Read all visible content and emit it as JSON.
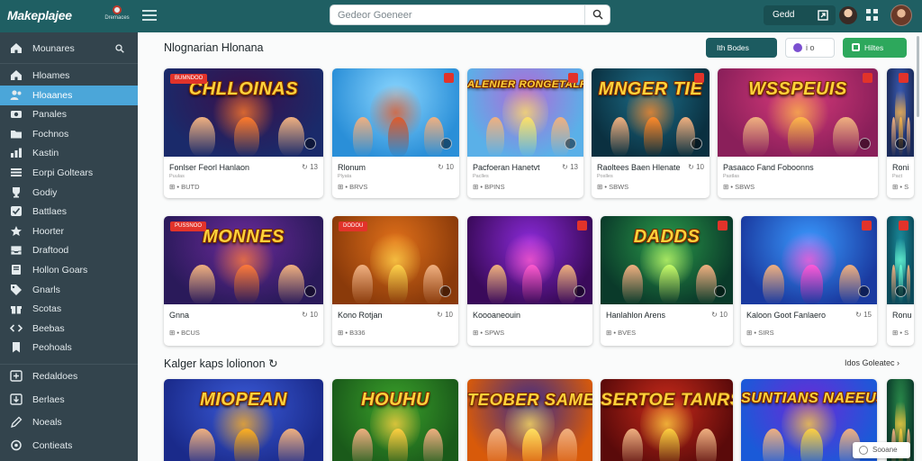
{
  "app": {
    "logo": "Makeplajee",
    "badge_label": "Dremaces",
    "search_placeholder": "Gedeor Goeneer",
    "top_pill_label": "Gedd"
  },
  "sidebar": {
    "header": "Mounares",
    "items": [
      {
        "label": "Hloames",
        "icon": "home-icon"
      },
      {
        "label": "Hloaanes",
        "icon": "users-icon",
        "active": true
      },
      {
        "label": "Panales",
        "icon": "camera-icon"
      },
      {
        "label": "Fochnos",
        "icon": "folder-icon"
      },
      {
        "label": "Kastin",
        "icon": "chart-icon"
      },
      {
        "label": "Eorpi Goltears",
        "icon": "list-icon"
      },
      {
        "label": "Godiy",
        "icon": "trophy-icon"
      },
      {
        "label": "Battlaes",
        "icon": "check-icon"
      },
      {
        "label": "Hoorter",
        "icon": "star-icon"
      },
      {
        "label": "Draftood",
        "icon": "inbox-icon"
      },
      {
        "label": "Hollon Goars",
        "icon": "book-icon"
      },
      {
        "label": "Gnarls",
        "icon": "tag-icon"
      },
      {
        "label": "Scotas",
        "icon": "gift-icon"
      },
      {
        "label": "Beebas",
        "icon": "code-icon"
      },
      {
        "label": "Peohoals",
        "icon": "bookmark-icon"
      }
    ],
    "footer_items": [
      {
        "label": "Redaldoes",
        "icon": "plus-square-icon"
      },
      {
        "label": "Berlaes",
        "icon": "download-icon"
      },
      {
        "label": "Noeals",
        "icon": "pencil-icon"
      },
      {
        "label": "Contieats",
        "icon": "settings-icon"
      }
    ]
  },
  "toolbar": {
    "primary_label": "Ith Bodes",
    "secondary_label": "i o",
    "green_label": "Hiltes"
  },
  "section1": {
    "title": "Nlognarian Hlonana"
  },
  "section2": {
    "title": "Kalger kaps lolionon",
    "link": "Idos Goleatec"
  },
  "row1": [
    {
      "art_title": "CHLLOINAS",
      "tag": "BUMNDOO",
      "name": "Fonlser Feorl Hanlaon",
      "acts": "↻ 13",
      "sub": "Puulas",
      "meta": "⊞ • BUTD",
      "palette": [
        "#1a2a6a",
        "#3a0f4a",
        "#ff7a2a"
      ]
    },
    {
      "art_title": "",
      "tag": "",
      "name": "Rlonum",
      "acts": "↻ 10",
      "sub": "Plyata",
      "meta": "⊞ • BRVS",
      "palette": [
        "#2a8fd8",
        "#8ad6ff",
        "#e05a2a"
      ]
    },
    {
      "art_title": "ALENIER RONGETALRS",
      "tag": "",
      "name": "Pacfoeran Hanetvt",
      "acts": "↻ 13",
      "sub": "Paclles",
      "meta": "⊞ • BPINS",
      "palette": [
        "#5ab0e8",
        "#b06ad8",
        "#ffe066"
      ]
    },
    {
      "art_title": "MNGER TIE",
      "tag": "",
      "name": "Raoltees Baen Hlenate",
      "acts": "↻ 10",
      "sub": "Poslles",
      "meta": "⊞ • SBWS",
      "palette": [
        "#0a3040",
        "#1d6f8a",
        "#ff8a2a"
      ]
    },
    {
      "art_title": "WSSPEUIS",
      "tag": "",
      "name": "Pasaaco Fand Foboonns",
      "acts": "",
      "sub": "Pastlas",
      "meta": "⊞ • SBWS",
      "palette": [
        "#8a1f5a",
        "#d83a7a",
        "#ffb84a"
      ]
    },
    {
      "art_title": "",
      "tag": "",
      "name": "Roni",
      "acts": "",
      "sub": "Pact",
      "meta": "⊞ • S",
      "palette": [
        "#1a2a5a",
        "#3a5ab0",
        "#ffb84a"
      ]
    }
  ],
  "row2": [
    {
      "art_title": "MONNES",
      "tag": "PUSSNOO",
      "name": "Gnna",
      "acts": "↻ 10",
      "meta": "⊞ • BCUS",
      "palette": [
        "#2a1a5a",
        "#6a2a9a",
        "#ff7a3a"
      ]
    },
    {
      "art_title": "",
      "tag": "DODOU",
      "name": "Kono Rotjan",
      "acts": "↻ 10",
      "meta": "⊞ • B336",
      "palette": [
        "#8a3a0a",
        "#e0701a",
        "#ffd24a"
      ]
    },
    {
      "art_title": "",
      "tag": "",
      "name": "Koooaneouin",
      "acts": "",
      "meta": "⊞ • SPWS",
      "palette": [
        "#3a0a5a",
        "#8a2ad8",
        "#ff5ad0"
      ]
    },
    {
      "art_title": "DADDS",
      "tag": "",
      "name": "Hanlahlon Arens",
      "acts": "↻ 10",
      "meta": "⊞ • BVES",
      "palette": [
        "#0a3a2a",
        "#2a9a4a",
        "#c8ff6a"
      ]
    },
    {
      "art_title": "",
      "tag": "",
      "name": "Kaloon Goot Fanlaero",
      "acts": "↻ 15",
      "meta": "⊞ • SIRS",
      "palette": [
        "#1a3aa0",
        "#3a9aff",
        "#ff5ad8"
      ]
    },
    {
      "art_title": "",
      "tag": "",
      "name": "Ronu",
      "acts": "",
      "meta": "⊞ • S",
      "palette": [
        "#0a4a5a",
        "#1a8a9a",
        "#6affd8"
      ]
    }
  ],
  "row3": [
    {
      "art_title": "MIOPEAN",
      "palette": [
        "#1a2a8a",
        "#3a5ad8",
        "#ffb020"
      ]
    },
    {
      "art_title": "HOUHU",
      "palette": [
        "#1a5a1a",
        "#3aa02a",
        "#ffd040"
      ]
    },
    {
      "art_title": "TEOBER SAMER",
      "palette": [
        "#d85a0a",
        "#3a2a8a",
        "#ffe060"
      ]
    },
    {
      "art_title": "SERTOE TANRS",
      "palette": [
        "#5a0a0a",
        "#c82a1a",
        "#ffd040"
      ]
    },
    {
      "art_title": "SUNTIANS NAEEUS",
      "palette": [
        "#1a5ad8",
        "#6a2ad8",
        "#ffd040"
      ]
    },
    {
      "art_title": "",
      "palette": [
        "#0a3a2a",
        "#2a8a4a",
        "#ffd040"
      ]
    }
  ],
  "toast": {
    "label": "Sooane"
  }
}
